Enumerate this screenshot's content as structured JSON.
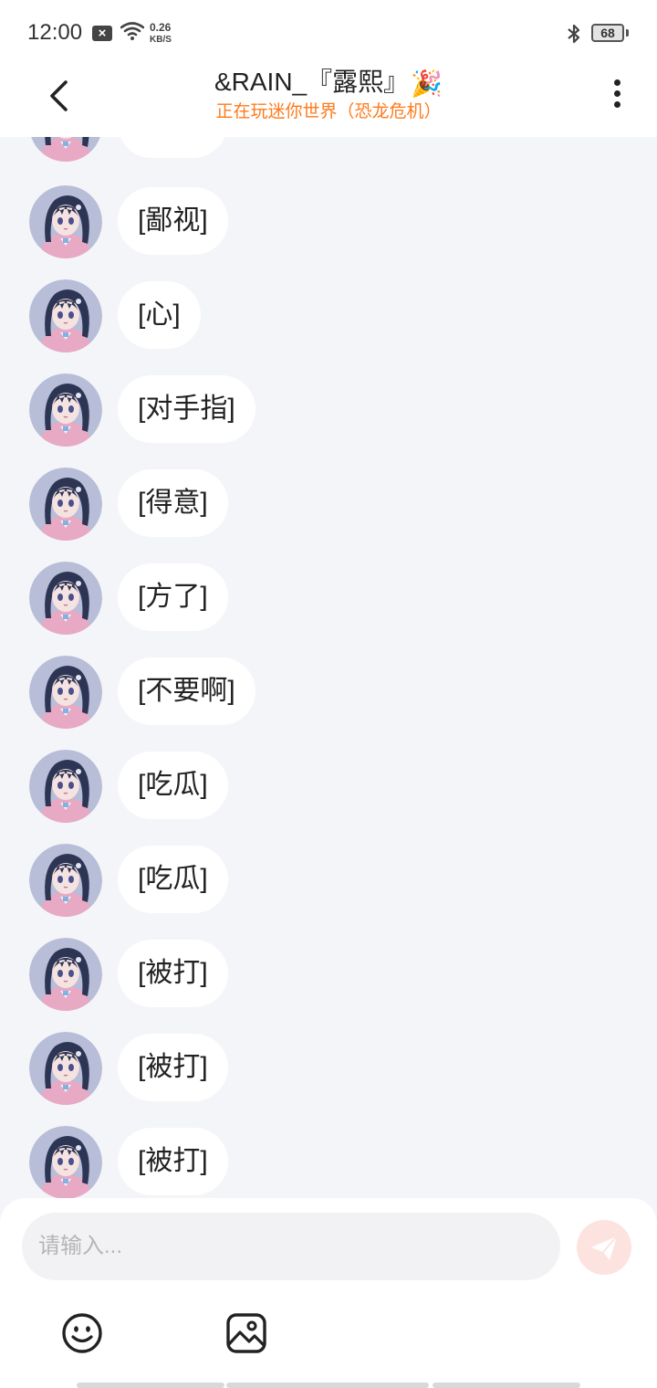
{
  "status_bar": {
    "time": "12:00",
    "notification_icon": "close-box-icon",
    "net_speed_value": "0.26",
    "net_speed_unit": "KB/S",
    "battery": "68",
    "icons": [
      "wifi-icon",
      "bluetooth-icon",
      "battery-icon"
    ]
  },
  "header": {
    "title": "&RAIN_『露熙』",
    "title_icon": "🎉",
    "subtitle": "正在玩迷你世界（恐龙危机）",
    "subtitle_color": "#ff7a1a",
    "back_icon": "chevron-left-icon",
    "more_icon": "more-vertical-icon"
  },
  "messages": [
    {
      "text": "[鄙视]"
    },
    {
      "text": "[心]"
    },
    {
      "text": "[对手指]"
    },
    {
      "text": "[得意]"
    },
    {
      "text": "[方了]"
    },
    {
      "text": "[不要啊]"
    },
    {
      "text": "[吃瓜]"
    },
    {
      "text": "[吃瓜]"
    },
    {
      "text": "[被打]"
    },
    {
      "text": "[被打]"
    },
    {
      "text": "[被打]"
    }
  ],
  "input": {
    "placeholder": "请输入...",
    "send_icon": "paper-plane-icon",
    "toolbar_icons": [
      "emoji-icon",
      "image-icon"
    ]
  },
  "colors": {
    "background": "#f4f5f8",
    "bubble": "#ffffff",
    "send_button": "#fde3df",
    "accent": "#ff7a1a"
  }
}
